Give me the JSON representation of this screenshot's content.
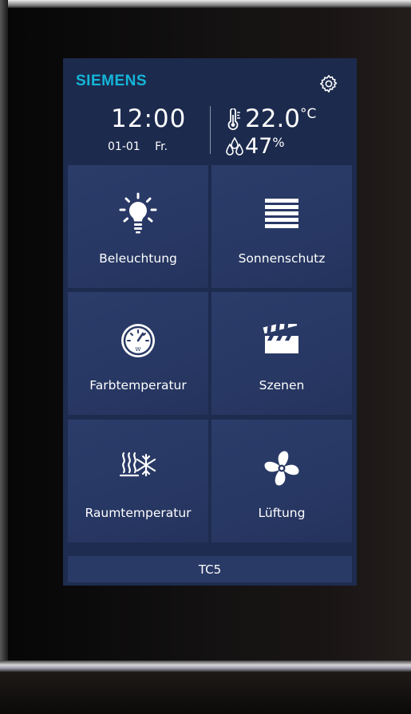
{
  "header": {
    "brand": "SIEMENS",
    "time": "12:00",
    "date": "01-01 Fr.",
    "temperature": "22.0",
    "temperature_unit": "°C",
    "humidity": "47",
    "humidity_unit": "%",
    "settings_icon": "gear-icon",
    "temperature_icon": "thermometer-icon",
    "humidity_icon": "humidity-drops-icon"
  },
  "tiles": [
    {
      "label": "Beleuchtung",
      "icon": "light-bulb-icon"
    },
    {
      "label": "Sonnenschutz",
      "icon": "blinds-icon"
    },
    {
      "label": "Farbtemperatur",
      "icon": "gauge-icon"
    },
    {
      "label": "Szenen",
      "icon": "clapperboard-icon"
    },
    {
      "label": "Raumtemperatur",
      "icon": "heat-cool-icon"
    },
    {
      "label": "Lüftung",
      "icon": "fan-icon"
    }
  ],
  "footer": {
    "label": "TC5"
  },
  "colors": {
    "brand": "#14b6d8",
    "screen_bg": "#1e2c50",
    "tile_bg": "#283864",
    "text": "#ffffff"
  }
}
